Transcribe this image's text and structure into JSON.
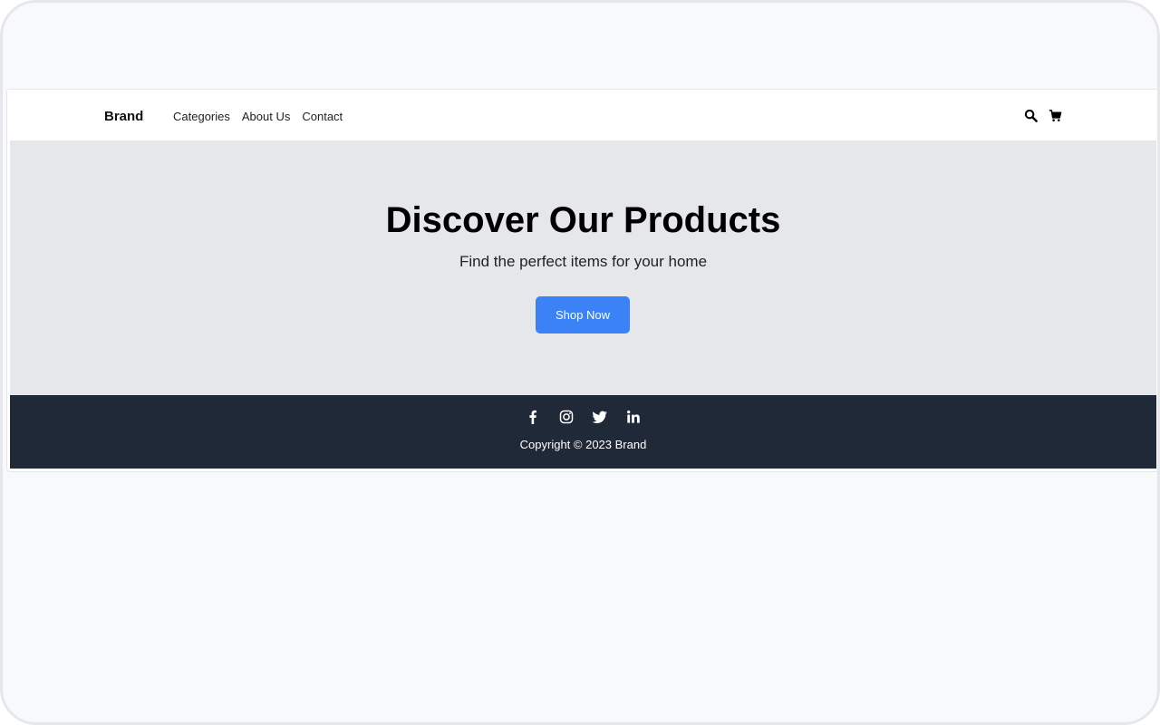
{
  "navbar": {
    "brand": "Brand",
    "links": [
      "Categories",
      "About Us",
      "Contact"
    ],
    "icons": [
      "search-icon",
      "cart-icon"
    ]
  },
  "hero": {
    "title": "Discover Our Products",
    "subtitle": "Find the perfect items for your home",
    "button_label": "Shop Now"
  },
  "footer": {
    "social_icons": [
      "facebook-icon",
      "instagram-icon",
      "twitter-icon",
      "linkedin-icon"
    ],
    "copyright": "Copyright © 2023 Brand"
  },
  "colors": {
    "accent": "#3b82f6",
    "hero_bg": "#e5e7eb",
    "footer_bg": "#1f2937",
    "page_bg": "#f8f9fb"
  }
}
